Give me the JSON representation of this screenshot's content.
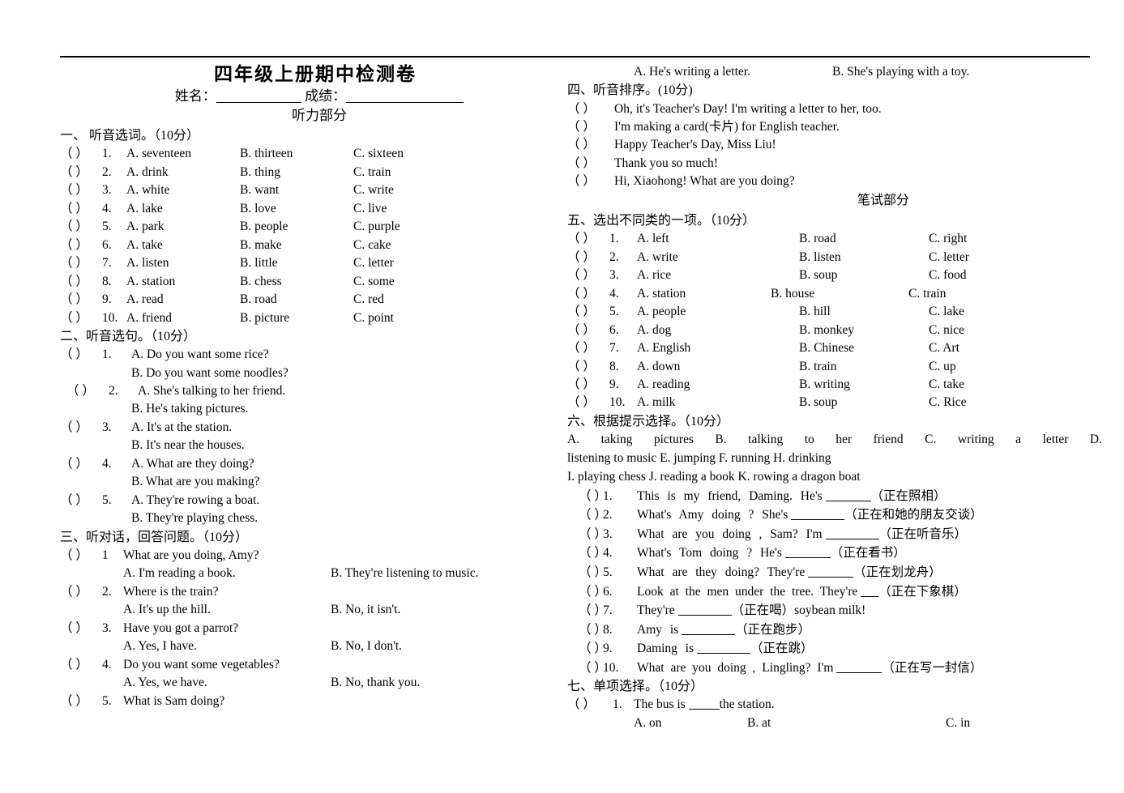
{
  "document": {
    "title": "四年级上册期中检测卷",
    "name_label": "姓名：",
    "score_label": "成绩：",
    "listening_part": "听力部分",
    "written_part": "笔试部分"
  },
  "section1": {
    "heading": "一、 听音选词。（10分）",
    "items": [
      {
        "paren": "（        ）",
        "num": "1.",
        "a": "A. seventeen",
        "b": "B. thirteen",
        "c": "C. sixteen"
      },
      {
        "paren": "（        ）",
        "num": "2.",
        "a": "A. drink",
        "b": "B. thing",
        "c": "C. train"
      },
      {
        "paren": "（        ）",
        "num": "3.",
        "a": "A. white",
        "b": "B. want",
        "c": "C. write"
      },
      {
        "paren": "（        ）",
        "num": "4.",
        "a": "A. lake",
        "b": "B. love",
        "c": "C. live"
      },
      {
        "paren": "（        ）",
        "num": "5.",
        "a": "A. park",
        "b": "B. people",
        "c": "C. purple"
      },
      {
        "paren": "（        ）",
        "num": "6.",
        "a": "A. take",
        "b": "B. make",
        "c": "C. cake"
      },
      {
        "paren": "（        ）",
        "num": "7.",
        "a": "A. listen",
        "b": "B. little",
        "c": "C. letter"
      },
      {
        "paren": "（        ）",
        "num": "8.",
        "a": "A. station",
        "b": "B. chess",
        "c": "C. some"
      },
      {
        "paren": "（        ）",
        "num": "9.",
        "a": "A. read",
        "b": "B. road",
        "c": "C. red"
      },
      {
        "paren": "（        ）",
        "num": "10.",
        "a": "A. friend",
        "b": "B. picture",
        "c": "C. point"
      }
    ]
  },
  "section2": {
    "heading": "二、听音选句。（10分）",
    "items": [
      {
        "num": "1.",
        "a": "A. Do you want some rice?",
        "b": "B. Do you want some noodles?"
      },
      {
        "num": "2.",
        "a": "A. She's talking to her friend.",
        "b": "B. He's taking pictures."
      },
      {
        "num": "3.",
        "a": "A. It's at the station.",
        "b": "B. It's near the houses."
      },
      {
        "num": "4.",
        "a": "A. What are they doing?",
        "b": "B. What are you making?"
      },
      {
        "num": "5.",
        "a": "A. They're rowing a boat.",
        "b": "B. They're playing chess."
      }
    ]
  },
  "section3": {
    "heading": "三、听对话，回答问题。（10分）",
    "items": [
      {
        "num": "1",
        "q": "What are you doing, Amy?",
        "a": "A. I'm reading a book.",
        "b": "B. They're listening to music."
      },
      {
        "num": "2.",
        "q": "Where is the train?",
        "a": "A. It's up the hill.",
        "b": "B. No, it isn't."
      },
      {
        "num": "3.",
        "q": "Have you got a parrot?",
        "a": "A. Yes, I have.",
        "b": "B. No, I don't."
      },
      {
        "num": "4.",
        "q": "Do you want some vegetables?",
        "a": "A. Yes, we have.",
        "b": "B. No, thank you."
      },
      {
        "num": "5.",
        "q": "What is Sam doing?",
        "a": "",
        "b": ""
      }
    ]
  },
  "section3_carry": {
    "a": "A. He's writing a letter.",
    "b": "B. She's playing with a toy."
  },
  "section4": {
    "heading": "四、听音排序。(10分)",
    "items": [
      "Oh, it's Teacher's Day! I'm writing a letter to her, too.",
      "I'm making a card(卡片) for English teacher.",
      "Happy Teacher's Day, Miss Liu!",
      "Thank you so much!",
      "Hi, Xiaohong! What are you doing?"
    ]
  },
  "section5": {
    "heading": "五、选出不同类的一项。（10分）",
    "items": [
      {
        "num": "1.",
        "a": "A. left",
        "b": "B. road",
        "c": "C. right"
      },
      {
        "num": "2.",
        "a": "A. write",
        "b": "B. listen",
        "c": "C. letter"
      },
      {
        "num": "3.",
        "a": "A. rice",
        "b": "B. soup",
        "c": "C. food"
      },
      {
        "num": "4.",
        "a": "A. station",
        "b": "B. house",
        "c": "C. train"
      },
      {
        "num": "5.",
        "a": "A. people",
        "b": "B. hill",
        "c": "C. lake"
      },
      {
        "num": "6.",
        "a": "A. dog",
        "b": "B. monkey",
        "c": "C. nice"
      },
      {
        "num": "7.",
        "a": "A. English",
        "b": "B. Chinese",
        "c": "C. Art"
      },
      {
        "num": "8.",
        "a": "A. down",
        "b": "B. train",
        "c": "C. up"
      },
      {
        "num": "9.",
        "a": "A. reading",
        "b": "B. writing",
        "c": "C. take"
      },
      {
        "num": "10.",
        "a": "A. milk",
        "b": "B. soup",
        "c": "C. Rice"
      }
    ]
  },
  "section6": {
    "heading": "六、根据提示选择。（10分）",
    "bank_line1": "A. taking   pictures       B. talking   to   her   friend       C. writing   a   letter   D.",
    "bank_line2": "listening   to   music            E. jumping            F. running            H. drinking",
    "bank_line3": "I. playing   chess       J. reading   a   book     K. rowing   a   dragon   boat",
    "items": [
      {
        "num": "1.",
        "pre": "This   is   my   friend, Daming. He's",
        "blank": "blank-s",
        "post": "（正在照相）"
      },
      {
        "num": "2.",
        "pre": "What's   Amy   doing ?    She's",
        "blank": "blank-m",
        "post": "（正在和她的朋友交谈）"
      },
      {
        "num": "3.",
        "pre": "What   are   you   doing , Sam?   I'm",
        "blank": "blank-m",
        "post": "（正在听音乐）"
      },
      {
        "num": "4.",
        "pre": "What's   Tom   doing ?     He's",
        "blank": "blank-s",
        "post": "（正在看书）"
      },
      {
        "num": "5.",
        "pre": "What   are   they   doing?    They're",
        "blank": "blank-s",
        "post": "（正在划龙舟）"
      },
      {
        "num": "6.",
        "pre": "Look   at   the   men   under   the   tree. They're",
        "blank": "blank-xs",
        "post": "（正在下象棋）"
      },
      {
        "num": "7.",
        "pre": "They're",
        "blank": "blank-m",
        "post": "（正在喝）soybean   milk!"
      },
      {
        "num": "8.",
        "pre": "Amy   is",
        "blank": "blank-m",
        "post": "（正在跑步）"
      },
      {
        "num": "9.",
        "pre": "Daming   is",
        "blank": "blank-m",
        "post": "（正在跳）"
      },
      {
        "num": "10.",
        "pre": "What   are   you   doing , Lingling?    I'm",
        "blank": "blank-s",
        "post": "（正在写一封信）"
      }
    ]
  },
  "section7": {
    "heading": "七、单项选择。（10分）",
    "items": [
      {
        "num": "1.",
        "q_pre": "The bus is",
        "q_post": "the station.",
        "a": "A. on",
        "b": "B. at",
        "c": "C. in"
      }
    ]
  }
}
